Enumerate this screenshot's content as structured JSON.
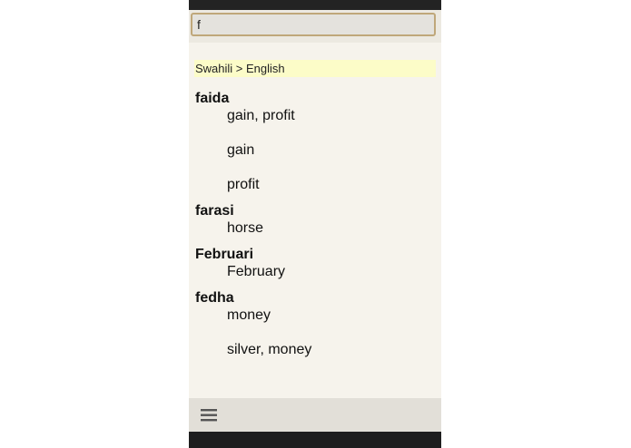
{
  "search": {
    "value": "f",
    "placeholder": ""
  },
  "dictionary": {
    "direction_label": "Swahili > English"
  },
  "entries": [
    {
      "headword": "faida",
      "definitions": [
        "gain, profit",
        "gain",
        "profit"
      ]
    },
    {
      "headword": "farasi",
      "definitions": [
        "horse"
      ]
    },
    {
      "headword": "Februari",
      "definitions": [
        "February"
      ]
    },
    {
      "headword": "fedha",
      "definitions": [
        "money",
        "silver, money"
      ]
    }
  ],
  "toolbar": {
    "menu_icon": "hamburger-menu-icon"
  },
  "colors": {
    "background": "#f6f3ec",
    "header_highlight": "#fcfcc8",
    "search_border": "#bfa77a",
    "status_bar": "#232323"
  }
}
